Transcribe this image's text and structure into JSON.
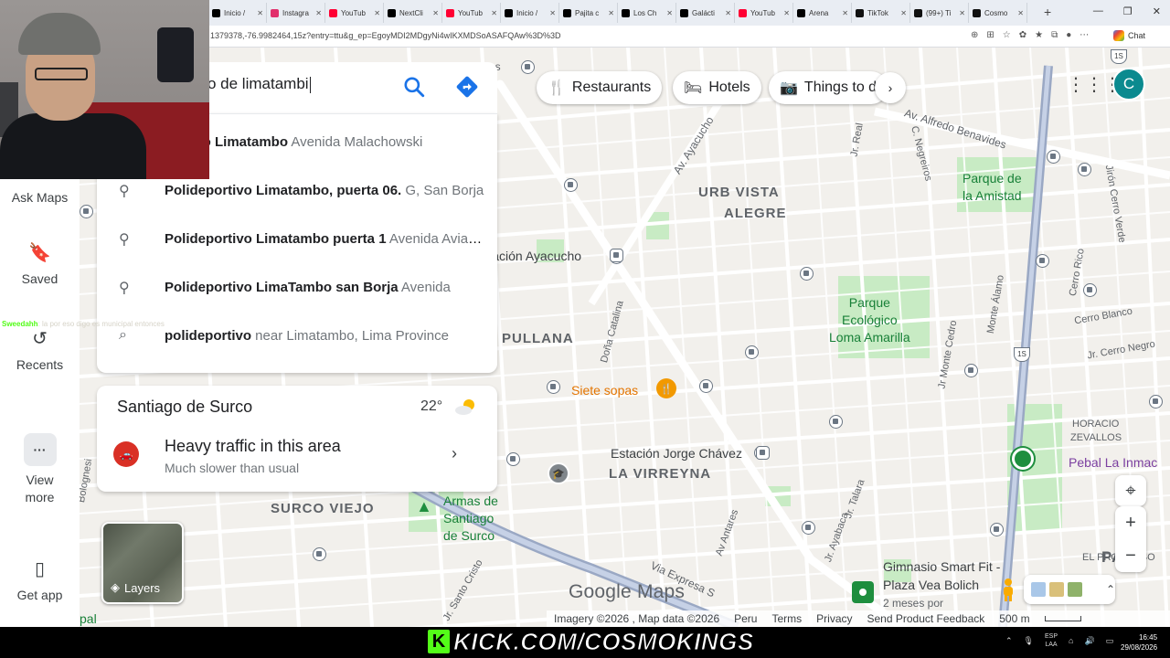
{
  "browser": {
    "tabs": [
      {
        "label": "Inicio /",
        "icon": "x-logo-icon",
        "color": "#000000"
      },
      {
        "label": "Instagra",
        "icon": "instagram-icon",
        "color": "#e1306c"
      },
      {
        "label": "YouTub",
        "icon": "youtube-icon",
        "color": "#ff0033"
      },
      {
        "label": "NextCli",
        "icon": "x-logo-icon",
        "color": "#000000"
      },
      {
        "label": "YouTub",
        "icon": "youtube-icon",
        "color": "#ff0033"
      },
      {
        "label": "Inicio /",
        "icon": "x-logo-icon",
        "color": "#000000"
      },
      {
        "label": "Pajita c",
        "icon": "x-logo-icon",
        "color": "#000000"
      },
      {
        "label": "Los Ch",
        "icon": "x-logo-icon",
        "color": "#000000"
      },
      {
        "label": "Galácti",
        "icon": "x-logo-icon",
        "color": "#000000"
      },
      {
        "label": "YouTub",
        "icon": "youtube-icon",
        "color": "#ff0033"
      },
      {
        "label": "Arena",
        "icon": "x-logo-icon",
        "color": "#000000"
      },
      {
        "label": "TikTok",
        "icon": "tiktok-icon",
        "color": "#111111"
      },
      {
        "label": "(99+) Ti",
        "icon": "tiktok-icon",
        "color": "#111111"
      },
      {
        "label": "Cosmo",
        "icon": "tiktok-icon",
        "color": "#111111"
      }
    ],
    "url": "1379378,-76.9982464,15z?entry=ttu&g_ep=EgoyMDI2MDgyNi4wIKXMDSoASAFQAw%3D%3D",
    "chat_label": "Chat"
  },
  "rail": {
    "ask_maps": "Ask Maps",
    "saved": "Saved",
    "recents": "Recents",
    "view_more_1": "View",
    "view_more_2": "more",
    "get_app": "Get app"
  },
  "search": {
    "query": "o de limatambi",
    "suggestions": [
      {
        "bold": "portivo Limatambo",
        "rest": " Avenida Malachowski",
        "icon": "pin-icon"
      },
      {
        "bold": "Polideportivo Limatambo, puerta 06.",
        "rest": " G, San Borja",
        "icon": "pin-icon"
      },
      {
        "bold": "Polideportivo Limatambo puerta 1",
        "rest": " Avenida Aviación",
        "icon": "pin-icon"
      },
      {
        "bold": "Polideportivo LimaTambo san Borja",
        "rest": " Avenida",
        "icon": "pin-icon"
      },
      {
        "bold": "polideportivo",
        "rest": " near Limatambo, Lima Province",
        "icon": "search-icon"
      }
    ]
  },
  "info_card": {
    "city": "Santiago de Surco",
    "temperature": "22°",
    "traffic_title": "Heavy traffic in this area",
    "traffic_sub": "Much slower than usual"
  },
  "chips": {
    "restaurants": "Restaurants",
    "hotels": "Hotels",
    "things_to_do": "Things to d"
  },
  "account_initial": "C",
  "map_labels": {
    "urb_vista_alegre_1": "URB VISTA",
    "urb_vista_alegre_2": "ALEGRE",
    "pullana": "PULLANA",
    "la_virreyna": "LA VIRREYNA",
    "surco_viejo": "SURCO VIEJO",
    "horacio_1": "HORACIO",
    "horacio_2": "ZEVALLOS",
    "el_progreso": "EL PROGRESO",
    "pam": "PAM",
    "parque_amistad_1": "Parque de",
    "parque_amistad_2": "la Amistad",
    "parque_loma_1": "Parque",
    "parque_loma_2": "Ecológico",
    "parque_loma_3": "Loma Amarilla",
    "estacion_ayacucho": "Estación Ayacucho",
    "estacion_jorge_chavez": "Estación Jorge Chávez",
    "siete_sopas": "Siete sopas",
    "armas_1": "Armas de",
    "armas_2": "Santiago",
    "armas_3": "de Surco",
    "pebal": "Pebal La Inmac",
    "gimnasio_1": "Gimnasio Smart Fit -",
    "gimnasio_2": "Plaza Vea Bolich",
    "gimnasio_3": "2 meses por",
    "av_ayacucho": "Av. Ayacucho",
    "av_alfredo": "Av. Alfredo Benavides",
    "jr_real": "Jr. Real",
    "c_negreiros": "C. Negreiros",
    "jiron_cerro_verde": "Jirón Cerro Verde",
    "cerro_rico": "Cerro Rico",
    "cerro_blanco": "Cerro Blanco",
    "jr_cerro_negro": "Jr. Cerro Negro",
    "monte_alamo": "Monte Álamo",
    "jr_monte_cedro": "Jr Monte Cedro",
    "dona_catalina": "Doña Catalina",
    "via_expresa": "Via Expresa S",
    "jr_talara": "Jr. Talara",
    "jr_ayabaca": "Jr. Ayabaca",
    "av_ antares": "Av Antares",
    "jr_santo_cristo": "Jr. Santo Cristo",
    "ditos": "itos",
    "bolognesi": "Bolognesi",
    "pal": "pal",
    "route_1s": "1S"
  },
  "layers_label": "Layers",
  "footer": {
    "brand": "Google Maps",
    "imagery": "Imagery ©2026 , Map data ©2026",
    "peru": "Peru",
    "terms": "Terms",
    "privacy": "Privacy",
    "feedback": "Send Product Feedback",
    "scale": "500 m"
  },
  "stream": {
    "chat_user": "Sweedahh",
    "chat_text": ": la por eso digo es municipal entonces",
    "kick_text": "KICK.COM/COSMOKINGS",
    "kick_color": "#53fc18"
  },
  "taskbar": {
    "lang_1": "ESP",
    "lang_2": "LAA",
    "time": "16:45",
    "date": "29/08/2026"
  },
  "colors": {
    "park": "#c8ebc4",
    "road": "#ffffff",
    "highway": "#9aa8c4",
    "accent": "#1a73e8",
    "traffic": "#d93025"
  }
}
